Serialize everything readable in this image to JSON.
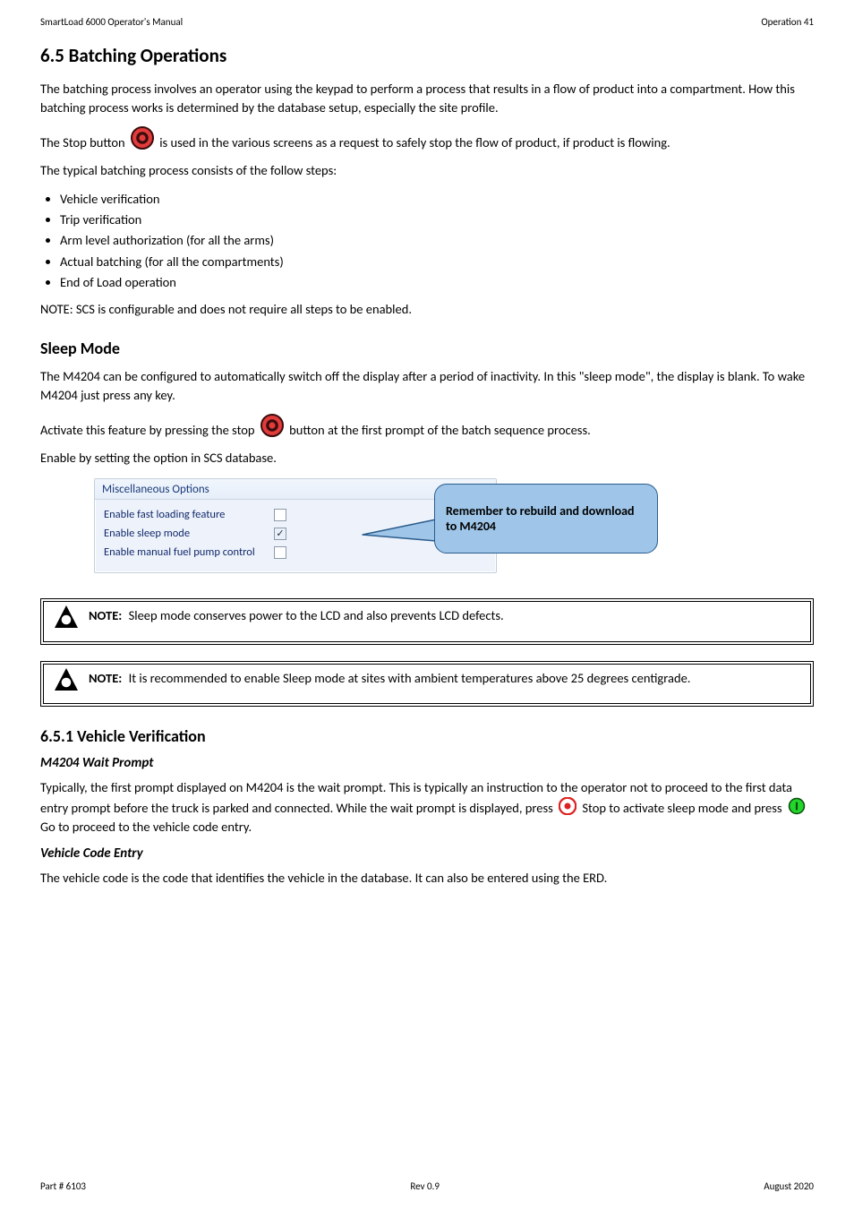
{
  "header": {
    "manual": "SmartLoad 6000 Operator's Manual",
    "page_label": "Operation 41"
  },
  "section_heading": "6.5 Batching Operations",
  "intro": "The batching process involves an operator using the keypad to perform a process that results in a flow of product into a compartment. How this batching process works is determined by the database setup, especially the site profile.",
  "stop_icon": {
    "name": "Stop",
    "sentence_prefix": "The Stop button ",
    "sentence_suffix": " is used in the various screens as a request to safely stop the flow of product, if product is flowing."
  },
  "batch_process_intro": "The typical batching process consists of the follow steps:",
  "steps": [
    "Vehicle verification",
    "Trip verification",
    "Arm level authorization (for all the arms)",
    "Actual batching (for all the compartments)",
    "End of Load operation"
  ],
  "steps_note": "NOTE: SCS is configurable and does not require all steps to be enabled.",
  "sleep_mode_heading": "Sleep Mode",
  "sleep_mode_para1": "The M4204 can be configured to automatically switch off the display after a period of inactivity. In this \"sleep mode\", the display is blank. To wake M4204 just press any key.",
  "sleep_mode_para2_prefix": "Activate this feature by pressing the stop ",
  "sleep_mode_para2_suffix": " button at the first prompt of the batch sequence process.",
  "enable_text": "Enable by setting the option in SCS database.",
  "groupbox": {
    "title": "Miscellaneous Options",
    "rows": [
      {
        "label": "Enable fast loading feature",
        "checked": false
      },
      {
        "label": "Enable sleep mode",
        "checked": true
      },
      {
        "label": "Enable manual fuel pump control",
        "checked": false
      }
    ]
  },
  "callout_text": "Remember to rebuild and download to M4204",
  "notebox1_text": "Sleep mode conserves power to the LCD and also prevents LCD defects.",
  "notebox2_text": "It is recommended to enable Sleep mode at sites with ambient temperatures above 25 degrees centigrade.",
  "note_label": "NOTE:",
  "vehicle_heading": "6.5.1 Vehicle Verification",
  "wait_prompt_title": "M4204 Wait Prompt",
  "wait_para_pre": "Typically, the first prompt displayed on M4204 is the wait prompt. This is typically an instruction to the operator not to proceed to the first data entry prompt before the truck is parked and connected. While the wait prompt is displayed, press ",
  "stop_small_word": "Stop",
  "wait_para_mid": " to activate sleep mode and press ",
  "go_word": "Go",
  "wait_para_post": " to proceed to the vehicle code entry.",
  "vehicle_code_title": "Vehicle Code Entry",
  "vehicle_code_text": "The vehicle code is the code that identifies the vehicle in the database. It can also be entered using the ERD.",
  "footer": {
    "part": "Part # 6103",
    "rev": "Rev 0.9",
    "date": "August 2020"
  }
}
